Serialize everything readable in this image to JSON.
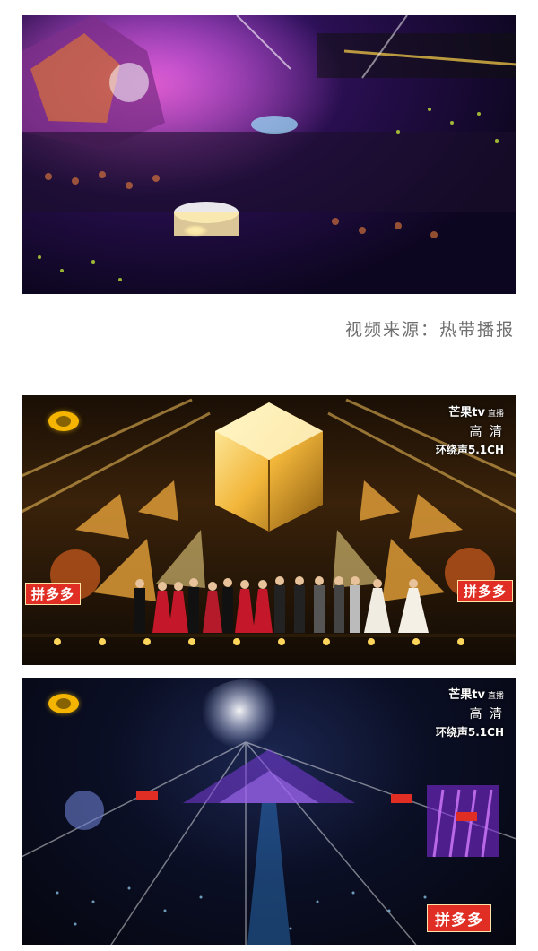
{
  "caption": "视频来源：热带播报",
  "photos": [
    {
      "scene": "aerial-stadium-concert"
    },
    {
      "scene": "golden-stage-performers"
    },
    {
      "scene": "wide-stadium-light-show"
    }
  ],
  "overlay": {
    "brand": "芒果tv",
    "live": "直播",
    "quality": "高 清",
    "audio": "环绕声5.1CH",
    "sponsor": "拼多多"
  },
  "colors": {
    "sponsor_red": "#e02e24",
    "stage_gold": "#f2b63a",
    "caption_gray": "#6f6f6f"
  }
}
